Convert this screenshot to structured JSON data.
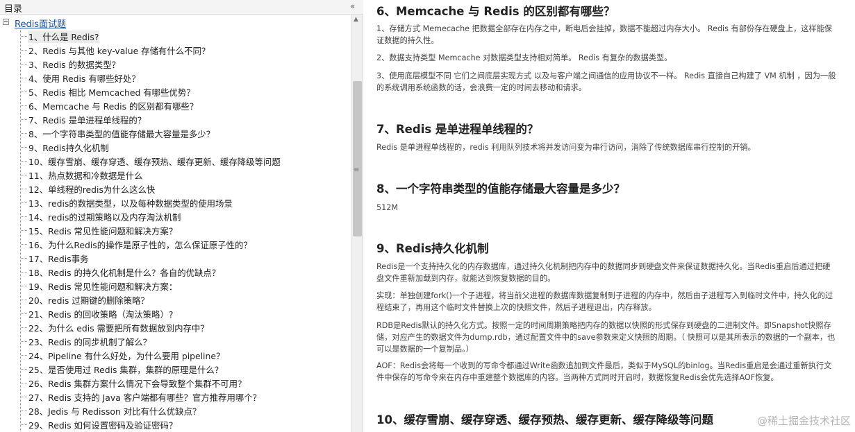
{
  "toc": {
    "title": "目录",
    "collapse_label": "«",
    "root_label": "Redis面试题",
    "items": [
      "1、什么是 Redis?",
      "2、Redis 与其他 key-value 存储有什么不同？",
      "3、Redis 的数据类型？",
      "4、使用 Redis 有哪些好处？",
      "5、Redis 相比 Memcached 有哪些优势？",
      "6、Memcache 与 Redis 的区别都有哪些？",
      "7、Redis 是单进程单线程的？",
      "8、一个字符串类型的值能存储最大容量是多少？",
      "9、Redis持久化机制",
      "10、缓存雪崩、缓存穿透、缓存预热、缓存更新、缓存降级等问题",
      "11、热点数据和冷数据是什么",
      "12、单线程的redis为什么这么快",
      "13、redis的数据类型，以及每种数据类型的使用场景",
      "14、redis的过期策略以及内存淘汰机制",
      "15、Redis 常见性能问题和解决方案？",
      "16、为什么Redis的操作是原子性的，怎么保证原子性的？",
      "17、Redis事务",
      "18、Redis 的持久化机制是什么？各自的优缺点？",
      "19、Redis 常见性能问题和解决方案：",
      "20、redis 过期键的删除策略？",
      "21、Redis 的回收策略（淘汰策略）?",
      "22、为什么 edis 需要把所有数据放到内存中？",
      "23、Redis 的同步机制了解么？",
      "24、Pipeline 有什么好处，为什么要用 pipeline？",
      "25、是否使用过 Redis 集群，集群的原理是什么？",
      "26、Redis 集群方案什么情况下会导致整个集群不可用？",
      "27、Redis 支持的 Java 客户端都有哪些？官方推荐用哪个？",
      "28、Jedis 与 Redisson 对比有什么优缺点？",
      "29、Redis 如何设置密码及验证密码？"
    ],
    "selected_index": 0
  },
  "scrollbar": {
    "up_arrow": "▲",
    "grip": "≡"
  },
  "content": {
    "s6": {
      "heading": "6、Memcache 与 Redis 的区别都有哪些？",
      "p1": "1、存储方式 Memecache 把数据全部存在内存之中，断电后会挂掉，数据不能超过内存大小。 Redis 有部份存在硬盘上，这样能保证数据的持久性。",
      "p2": "2、数据支持类型 Memcache 对数据类型支持相对简单。 Redis 有复杂的数据类型。",
      "p3": "3、使用底层模型不同 它们之间底层实现方式 以及与客户端之间通信的应用协议不一样。 Redis 直接自己构建了 VM 机制 ，因为一般的系统调用系统函数的话，会浪费一定的时间去移动和请求。"
    },
    "s7": {
      "heading": "7、Redis 是单进程单线程的？",
      "p1": "Redis 是单进程单线程的，redis 利用队列技术将并发访问变为串行访问，消除了传统数据库串行控制的开销。"
    },
    "s8": {
      "heading": "8、一个字符串类型的值能存储最大容量是多少？",
      "p1": "512M"
    },
    "s9": {
      "heading": "9、Redis持久化机制",
      "p1": "Redis是一个支持持久化的内存数据库，通过持久化机制把内存中的数据同步到硬盘文件来保证数据持久化。当Redis重启后通过把硬盘文件重新加载到内存，就能达到恢复数据的目的。",
      "p2": "实现：单独创建fork()一个子进程，将当前父进程的数据库数据复制到子进程的内存中，然后由子进程写入到临时文件中，持久化的过程结束了，再用这个临时文件替换上次的快照文件，然后子进程退出，内存释放。",
      "p3": "RDB是Redis默认的持久化方式。按照一定的时间周期策略把内存的数据以快照的形式保存到硬盘的二进制文件。即Snapshot快照存储，对应产生的数据文件为dump.rdb，通过配置文件中的save参数来定义快照的周期。（ 快照可以是其所表示的数据的一个副本，也可以是数据的一个复制品。）",
      "p4": "AOF：Redis会将每一个收到的写命令都通过Write函数追加到文件最后，类似于MySQL的binlog。当Redis重启是会通过重新执行文件中保存的写命令来在内存中重建整个数据库的内容。当两种方式同时开启时，数据恢复Redis会优先选择AOF恢复。"
    },
    "s10": {
      "heading": "10、缓存雪崩、缓存穿透、缓存预热、缓存更新、缓存降级等问题"
    }
  },
  "watermark": "@稀土掘金技术社区"
}
